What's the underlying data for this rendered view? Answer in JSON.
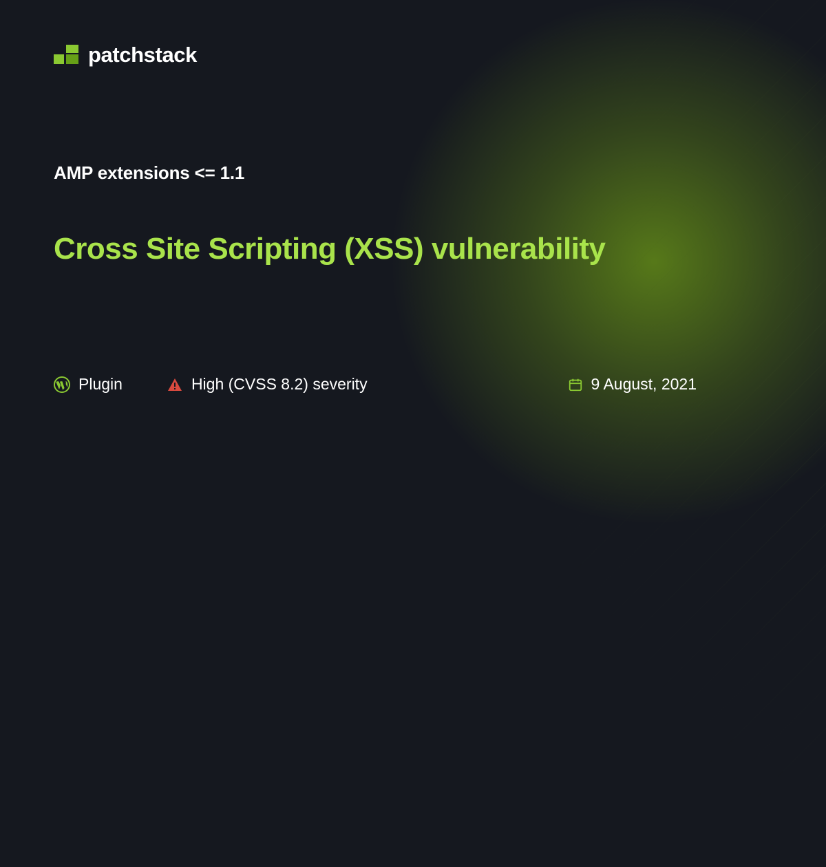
{
  "brand": {
    "name": "patchstack"
  },
  "affected": "AMP extensions <= 1.1",
  "title": "Cross Site Scripting (XSS) vulnerability",
  "meta": {
    "type": "Plugin",
    "severity": "High (CVSS 8.2) severity",
    "date": "9 August, 2021"
  },
  "colors": {
    "accent": "#A9E34B",
    "logo_light": "#8BC932",
    "logo_dark": "#66A017",
    "danger": "#D94A3F"
  }
}
